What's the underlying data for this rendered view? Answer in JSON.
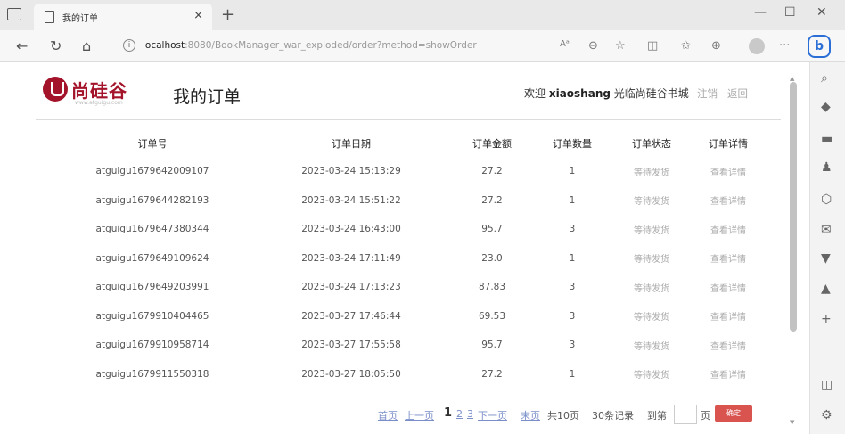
{
  "browser": {
    "tab_title": "我的订单",
    "new_tab_glyph": "+",
    "tab_close_glyph": "×",
    "url_host": "localhost",
    "url_rest": ":8080/BookManager_war_exploded/order?method=showOrder",
    "bing_label": "b",
    "window_controls": [
      "—",
      "☐",
      "✕"
    ],
    "nav_glyphs": {
      "back": "←",
      "refresh": "↻",
      "home": "⌂"
    },
    "toolbar_icons": [
      "read-aloud-icon",
      "zoom-icon",
      "favorite-add-icon",
      "split-screen-icon",
      "favorites-icon",
      "collections-icon",
      "profile-icon",
      "more-icon"
    ],
    "sidebar_icons": [
      "search-icon",
      "tag-icon",
      "briefcase-icon",
      "games-icon",
      "office-icon",
      "outlook-icon",
      "shopping-icon",
      "bell-icon",
      "add-icon",
      "split-view-icon",
      "settings-icon"
    ]
  },
  "header": {
    "logo_text": "尚硅谷",
    "logo_sub": "www.atguigu.com",
    "page_title": "我的订单",
    "welcome_prefix": "欢迎",
    "username": "xiaoshang",
    "welcome_suffix": "光临尚硅谷书城",
    "logout_label": "注销",
    "back_label": "返回"
  },
  "table": {
    "columns": [
      "订单号",
      "订单日期",
      "订单金额",
      "订单数量",
      "订单状态",
      "订单详情"
    ],
    "rows": [
      {
        "id": "atguigu1679642009107",
        "date": "2023-03-24 15:13:29",
        "amount": "27.2",
        "count": "1",
        "status": "等待发货",
        "detail": "查看详情"
      },
      {
        "id": "atguigu1679644282193",
        "date": "2023-03-24 15:51:22",
        "amount": "27.2",
        "count": "1",
        "status": "等待发货",
        "detail": "查看详情"
      },
      {
        "id": "atguigu1679647380344",
        "date": "2023-03-24 16:43:00",
        "amount": "95.7",
        "count": "3",
        "status": "等待发货",
        "detail": "查看详情"
      },
      {
        "id": "atguigu1679649109624",
        "date": "2023-03-24 17:11:49",
        "amount": "23.0",
        "count": "1",
        "status": "等待发货",
        "detail": "查看详情"
      },
      {
        "id": "atguigu1679649203991",
        "date": "2023-03-24 17:13:23",
        "amount": "87.83",
        "count": "3",
        "status": "等待发货",
        "detail": "查看详情"
      },
      {
        "id": "atguigu1679910404465",
        "date": "2023-03-27 17:46:44",
        "amount": "69.53",
        "count": "3",
        "status": "等待发货",
        "detail": "查看详情"
      },
      {
        "id": "atguigu1679910958714",
        "date": "2023-03-27 17:55:58",
        "amount": "95.7",
        "count": "3",
        "status": "等待发货",
        "detail": "查看详情"
      },
      {
        "id": "atguigu1679911550318",
        "date": "2023-03-27 18:05:50",
        "amount": "27.2",
        "count": "1",
        "status": "等待发货",
        "detail": "查看详情"
      }
    ]
  },
  "pager": {
    "first": "首页",
    "prev": "上一页",
    "current": "1",
    "pages": [
      "2",
      "3"
    ],
    "next": "下一页",
    "last": "末页",
    "total_pages": "共10页",
    "total_records": "30条记录",
    "goto_label": "到第",
    "page_suffix": "页",
    "confirm": "确定"
  }
}
